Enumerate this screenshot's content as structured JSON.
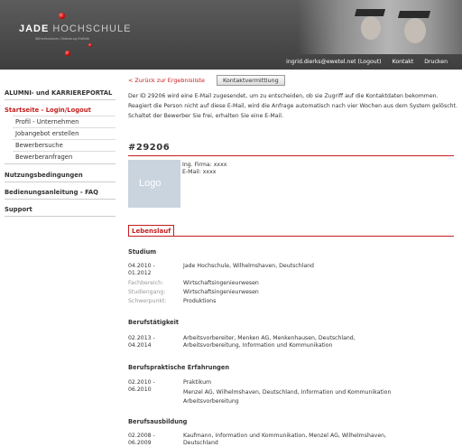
{
  "header": {
    "logo_jade": "JADE",
    "logo_hs": " HOCHSCHULE",
    "logo_sub": "Wilhelmshaven Oldenburg Elsfleth",
    "user_email": "ingrid.dierks@ewetel.net (Logout)",
    "kontakt": "Kontakt",
    "drucken": "Drucken"
  },
  "sidebar": {
    "portal": "ALUMNI- und KARRIEREPORTAL",
    "startseite": "Startseite - Login/Logout",
    "sub_items": [
      "Profil - Unternehmen",
      "Jobangebot erstellen",
      "Bewerbersuche",
      "Bewerberanfragen"
    ],
    "nutzung": "Nutzungsbedingungen",
    "anleitung": "Bedienungsanleitung - FAQ",
    "support": "Support"
  },
  "main": {
    "back_link": "< Zurück zur Ergebnisliste",
    "kontakt_button": "Kontaktvermittlung",
    "intro": "Der ID 29206 wird eine E-Mail zugesendet, um zu entscheiden, ob sie Zugriff auf die Kontaktdaten bekommen. Reagiert die Person nicht auf diese E-Mail, wird die Anfrage automatisch nach vier Wochen aus dem System gelöscht. Schaltet der Bewerber Sie frei, erhalten Sie eine E-Mail.",
    "id_title": "#29206",
    "logo_placeholder": "Logo",
    "contact_name": "Ing. Firma: xxxx",
    "contact_email": "E-Mail: xxxx",
    "lebenslauf_tab": "Lebenslauf"
  },
  "cv": {
    "studium": {
      "heading": "Studium",
      "date": "04.2010 -\n01.2012",
      "place": "Jade Hochschule, Wilhelmshaven, Deutschland",
      "fachbereich_label": "Fachbereich:",
      "fachbereich": "Wirtschaftsingenieurwesen",
      "studiengang_label": "Studiengang:",
      "studiengang": "Wirtschaftsingenieurwesen",
      "schwerpunkt_label": "Schwerpunkt:",
      "schwerpunkt": "Produktions"
    },
    "beruf": {
      "heading": "Berufstätigkeit",
      "date": "02.2013 -\n04.2014",
      "text": "Arbeitsvorbereiter, Menken AG, Menkenhausen, Deutschland,\nArbeitsvorbereitung, Information und Kommunikation"
    },
    "praxis": {
      "heading": "Berufspraktische Erfahrungen",
      "date": "02.2010 -\n06.2010",
      "text1": "Praktikum",
      "text2": "Menzel AG, Wilhelmshaven, Deutschland, Information und Kommunikation\nArbeitsvorbereitung"
    },
    "ausbildung": {
      "heading": "Berufsausbildung",
      "date": "02.2008 -\n06.2009",
      "text": "Kaufmann, Information und Kommunikation, Menzel AG, Wilhelmshaven,\nDeutschland"
    }
  }
}
